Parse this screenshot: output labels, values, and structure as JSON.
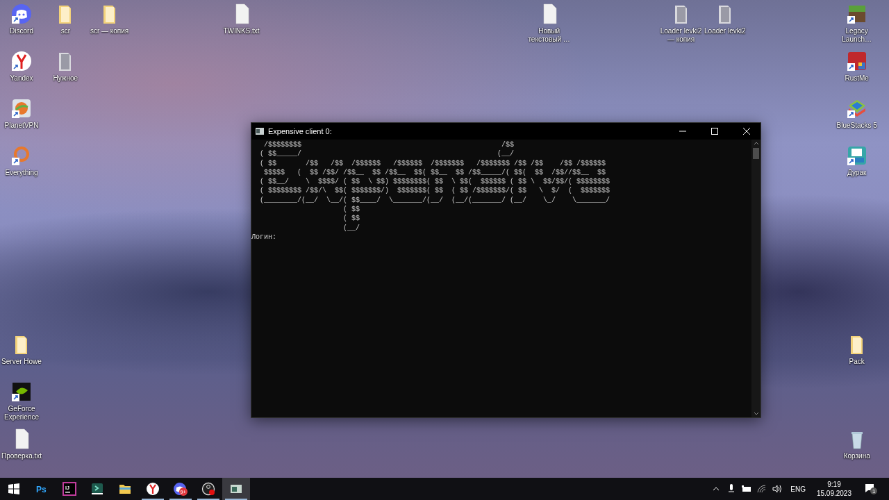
{
  "desktop": {
    "icons": [
      {
        "label": "Discord",
        "kind": "discord",
        "shortcut": true
      },
      {
        "label": "scr",
        "kind": "folder",
        "shortcut": false
      },
      {
        "label": "scr — копия",
        "kind": "folder",
        "shortcut": false
      },
      {
        "label": "TWINKS.txt",
        "kind": "file",
        "shortcut": false
      },
      {
        "label": "Новый текстовый …",
        "kind": "file",
        "shortcut": false
      },
      {
        "label": "Loader levki2 — копия",
        "kind": "archive",
        "shortcut": false
      },
      {
        "label": "Loader levki2",
        "kind": "archive",
        "shortcut": false
      },
      {
        "label": "Legacy Launch…",
        "kind": "minecraft",
        "shortcut": true
      },
      {
        "label": "Yandex",
        "kind": "yandex",
        "shortcut": true
      },
      {
        "label": "Нужное",
        "kind": "archive",
        "shortcut": false
      },
      {
        "label": "RustMe",
        "kind": "rustme",
        "shortcut": true
      },
      {
        "label": "PlanetVPN",
        "kind": "planetvpn",
        "shortcut": true
      },
      {
        "label": "BlueStacks 5",
        "kind": "bluestacks",
        "shortcut": true
      },
      {
        "label": "Everything",
        "kind": "everything",
        "shortcut": true
      },
      {
        "label": "Дурак",
        "kind": "durak",
        "shortcut": true
      },
      {
        "label": "Server Howe",
        "kind": "folder",
        "shortcut": false
      },
      {
        "label": "Pack",
        "kind": "folder",
        "shortcut": false
      },
      {
        "label": "GeForce Experience",
        "kind": "nvidia",
        "shortcut": true
      },
      {
        "label": "Проверка.txt",
        "kind": "file",
        "shortcut": false
      },
      {
        "label": "Корзина",
        "kind": "bin",
        "shortcut": false
      }
    ]
  },
  "console_window": {
    "title": "Expensive client 0:",
    "lines": [
      "   /$$$$$$$$                                                /$$",
      "  ( $$_____/                                               (__/",
      "  ( $$       /$$   /$$  /$$$$$$   /$$$$$$  /$$$$$$$   /$$$$$$$ /$$ /$$    /$$ /$$$$$$",
      "   $$$$$   (  $$ /$$/ /$$__  $$ /$$__  $$( $$__  $$ /$$_____/( $$(  $$  /$$//$$__  $$",
      "  ( $$__/    \\  $$$$/ ( $$  \\ $$) $$$$$$$$( $$  \\ $$(  $$$$$$ ( $$ \\  $$/$$/( $$$$$$$$",
      "  ( $$$$$$$$ /$$/\\  $$( $$$$$$$/)  $$$$$$$( $$  ( $$ /$$$$$$$/( $$   \\  $/  (  $$$$$$$",
      "  (________/(__/  \\__/( $$____/  \\_______/(__/  (__/(_______/ (__/    \\_/    \\_______/",
      "                      ( $$",
      "                      ( $$",
      "                      (__/"
    ],
    "prompt": "Логин:"
  },
  "taskbar": {
    "apps": [
      {
        "kind": "photoshop",
        "text": "Ps",
        "running": false,
        "active": false
      },
      {
        "kind": "intellij",
        "text": "IJ",
        "running": false,
        "active": false
      },
      {
        "kind": "terminal",
        "running": false,
        "active": false
      },
      {
        "kind": "explorer",
        "running": false,
        "active": false
      },
      {
        "kind": "yandex",
        "running": true,
        "active": false
      },
      {
        "kind": "discord",
        "badge": "9+",
        "running": true,
        "active": false
      },
      {
        "kind": "obs",
        "running": true,
        "active": false
      },
      {
        "kind": "console",
        "running": true,
        "active": true
      }
    ],
    "language": "ENG",
    "time": "9:19",
    "date": "15.09.2023",
    "notifications": "1"
  }
}
